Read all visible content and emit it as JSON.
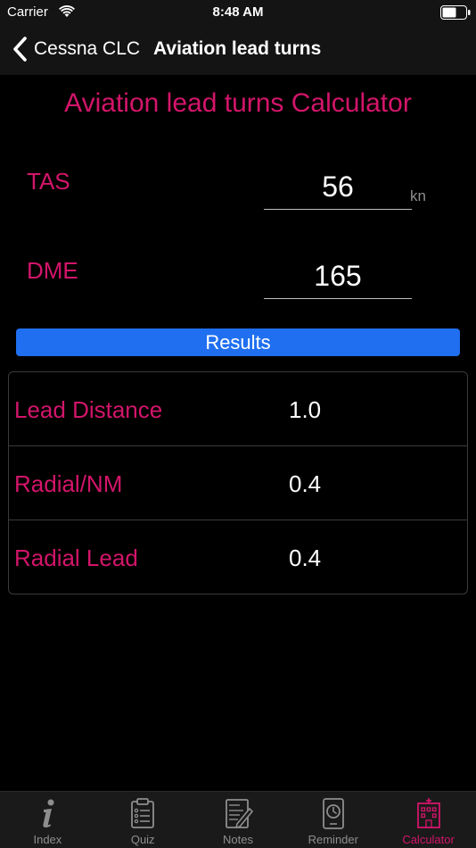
{
  "status_bar": {
    "carrier": "Carrier",
    "time": "8:48 AM"
  },
  "nav": {
    "back_label": "Cessna CLC",
    "title": "Aviation lead turns"
  },
  "calculator": {
    "title": "Aviation lead turns Calculator",
    "tas": {
      "label": "TAS",
      "value": "56",
      "unit": "kn"
    },
    "dme": {
      "label": "DME",
      "value": "165"
    },
    "results_button": "Results"
  },
  "results": [
    {
      "label": "Lead Distance",
      "value": "1.0"
    },
    {
      "label": "Radial/NM",
      "value": "0.4"
    },
    {
      "label": "Radial Lead",
      "value": "0.4"
    }
  ],
  "tabs": [
    {
      "label": "Index",
      "icon": "info-icon",
      "active": false
    },
    {
      "label": "Quiz",
      "icon": "clipboard-icon",
      "active": false
    },
    {
      "label": "Notes",
      "icon": "notes-icon",
      "active": false
    },
    {
      "label": "Reminder",
      "icon": "clock-icon",
      "active": false
    },
    {
      "label": "Calculator",
      "icon": "calculator-icon",
      "active": true
    }
  ],
  "colors": {
    "accent": "#d3156a",
    "button": "#1f6ff0",
    "background": "#000000"
  }
}
